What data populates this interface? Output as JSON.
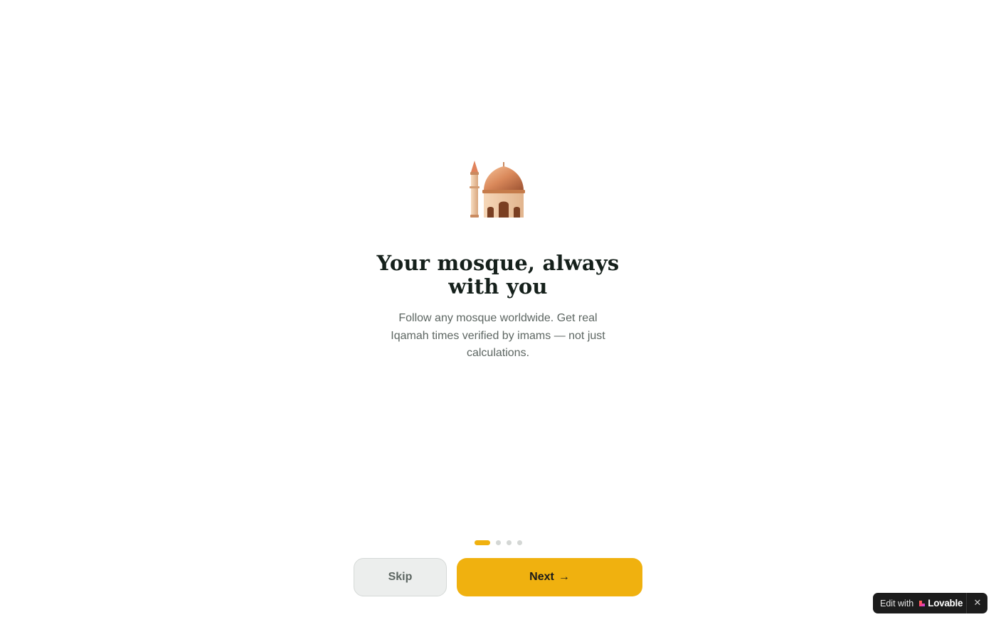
{
  "onboarding": {
    "icon": "mosque-icon",
    "title": "Your mosque, always with you",
    "subtitle": "Follow any mosque worldwide. Get real Iqamah times verified by imams — not just calculations.",
    "pagination": {
      "total_steps": 4,
      "current_step": 1
    },
    "skip_label": "Skip",
    "next_label": "Next",
    "next_icon": "arrow-right-icon"
  },
  "lovable_badge": {
    "prefix": "Edit with",
    "brand": "Lovable",
    "close_icon": "close-icon"
  },
  "colors": {
    "accent": "#f0b10f",
    "title": "#15201b",
    "body_text": "#5d6662",
    "skip_background": "#eceeed",
    "inactive_dot": "#d4d7d5",
    "badge_background": "#1c1c1c"
  }
}
